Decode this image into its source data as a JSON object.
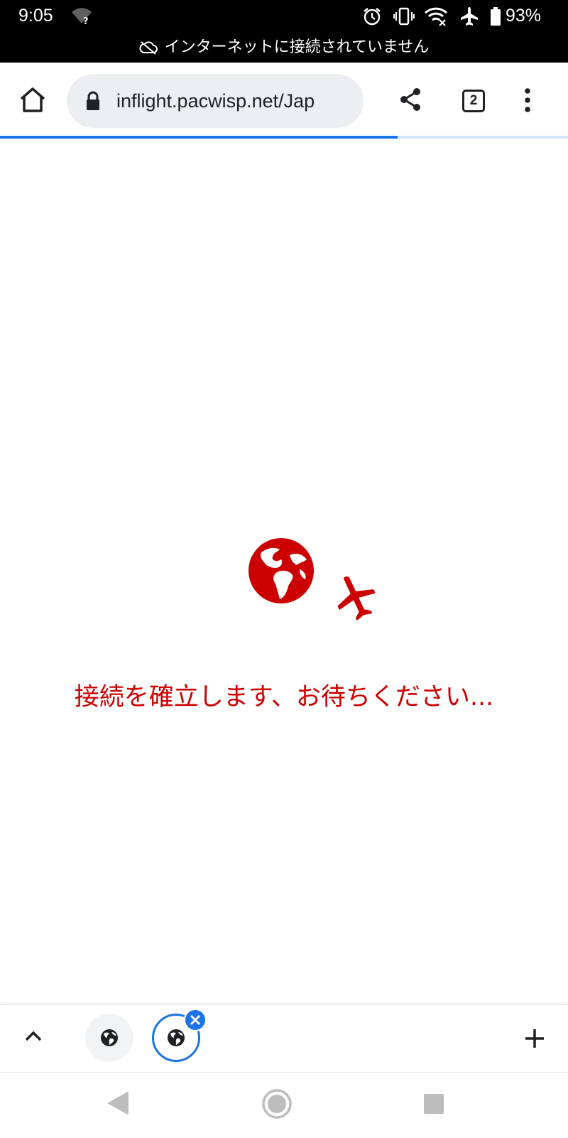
{
  "status_bar": {
    "time": "9:05",
    "battery": "93%",
    "offline_message": "インターネットに接続されていません",
    "icons": [
      "wifi-unknown-icon",
      "alarm-icon",
      "vibrate-icon",
      "wifi-x-icon",
      "airplane-mode-icon",
      "battery-icon"
    ]
  },
  "toolbar": {
    "url": "inflight.pacwisp.net/Jap",
    "tab_count": "2",
    "icons": [
      "home-icon",
      "lock-icon",
      "share-icon",
      "tab-switcher-icon",
      "more-menu-icon"
    ],
    "load_progress": 0.7,
    "progress_color": "#1a73e8"
  },
  "content": {
    "loading_message": "接続を確立します、お待ちください...",
    "accent_color": "#cc0000",
    "logo_icons": [
      "globe-icon",
      "airplane-icon"
    ]
  },
  "tab_strip": {
    "tabs": [
      {
        "icon": "globe-favicon-icon",
        "active": false
      },
      {
        "icon": "globe-favicon-icon",
        "active": true
      }
    ],
    "icons": [
      "chevron-up-icon",
      "close-tab-icon",
      "new-tab-plus-icon"
    ]
  },
  "nav_bar": {
    "icons": [
      "back-triangle-icon",
      "home-circle-icon",
      "recents-square-icon"
    ]
  }
}
